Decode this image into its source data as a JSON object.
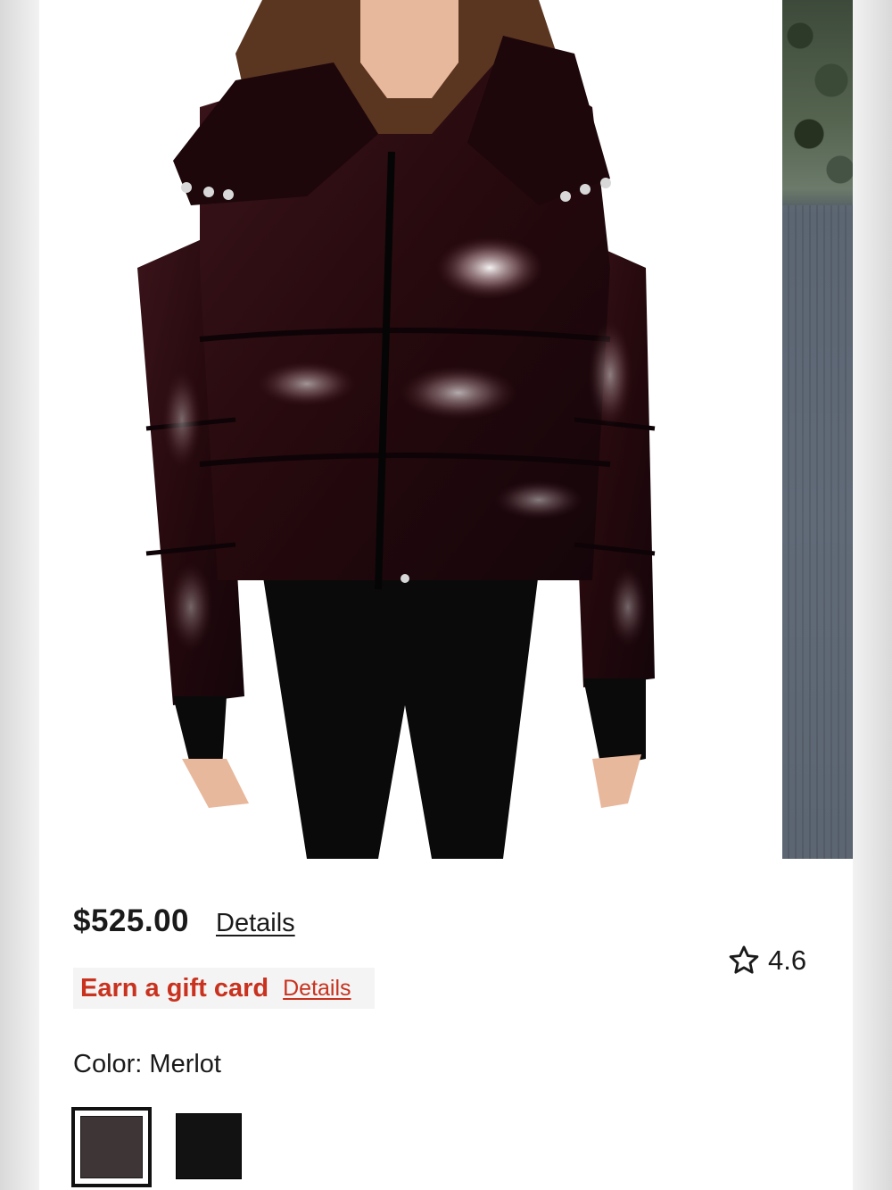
{
  "product": {
    "price": "$525.00",
    "price_details_label": "Details",
    "rating": "4.6",
    "gift_card": {
      "text": "Earn a gift card",
      "details_label": "Details"
    },
    "color": {
      "label": "Color: Merlot",
      "swatches": [
        {
          "name": "Merlot",
          "hex": "#3e3536",
          "selected": true
        },
        {
          "name": "Black",
          "hex": "#121212",
          "selected": false
        }
      ]
    }
  },
  "colors": {
    "accent_red": "#c8321e",
    "text": "#1a1a1a",
    "jacket": "#2a0f12"
  },
  "icons": {
    "rating": "star-outline-icon"
  }
}
